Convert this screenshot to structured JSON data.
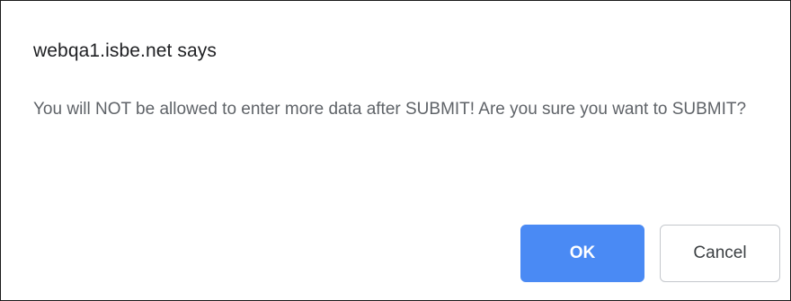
{
  "dialog": {
    "title": "webqa1.isbe.net says",
    "message": "You will NOT be allowed to enter more data after SUBMIT! Are you sure you want to SUBMIT?",
    "ok_label": "OK",
    "cancel_label": "Cancel",
    "colors": {
      "ok_background": "#4a8af4",
      "ok_text": "#ffffff",
      "cancel_border": "#c4c7cc",
      "message_text": "#5f6368",
      "title_text": "#202124"
    }
  }
}
